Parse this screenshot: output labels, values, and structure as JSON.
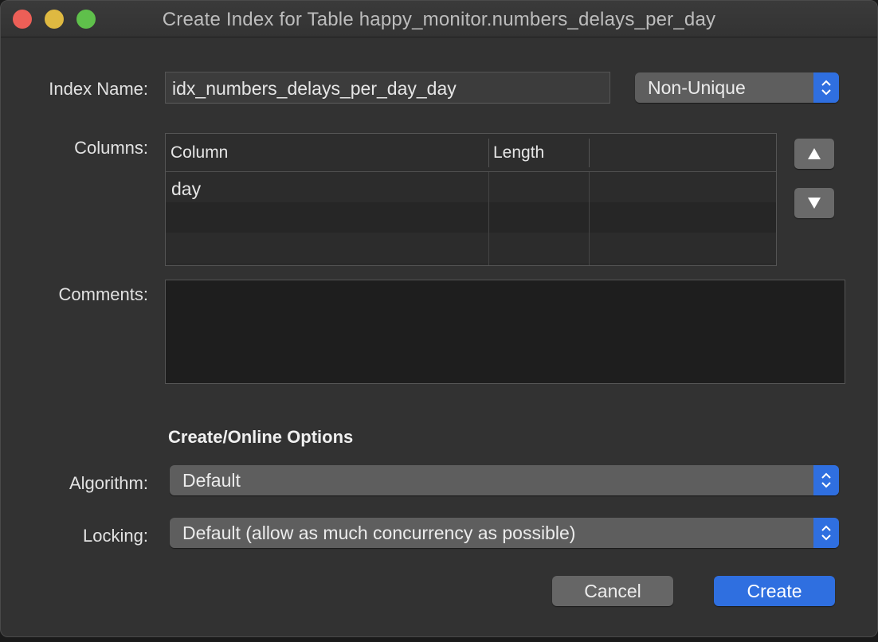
{
  "window": {
    "title": "Create Index for Table happy_monitor.numbers_delays_per_day"
  },
  "form": {
    "index_name_label": "Index Name:",
    "index_name_value": "idx_numbers_delays_per_day_day",
    "uniqueness_value": "Non-Unique",
    "columns_label": "Columns:",
    "comments_label": "Comments:",
    "comments_value": ""
  },
  "columns_table": {
    "headers": [
      "Column",
      "Length",
      ""
    ],
    "rows": [
      [
        "day",
        "",
        ""
      ],
      [
        "",
        "",
        ""
      ],
      [
        "",
        "",
        ""
      ]
    ]
  },
  "icons": {
    "move_up": "triangle-up-icon",
    "move_down": "triangle-down-icon",
    "popup_stepper": "chevron-up-down-icon"
  },
  "options": {
    "section_title": "Create/Online Options",
    "algorithm_label": "Algorithm:",
    "algorithm_value": "Default",
    "locking_label": "Locking:",
    "locking_value": "Default (allow as much concurrency as possible)"
  },
  "buttons": {
    "cancel": "Cancel",
    "create": "Create"
  },
  "colors": {
    "accent": "#2f6fe0",
    "close": "#ec5f57",
    "minimize": "#dfb941",
    "maximize": "#5fc04b"
  }
}
